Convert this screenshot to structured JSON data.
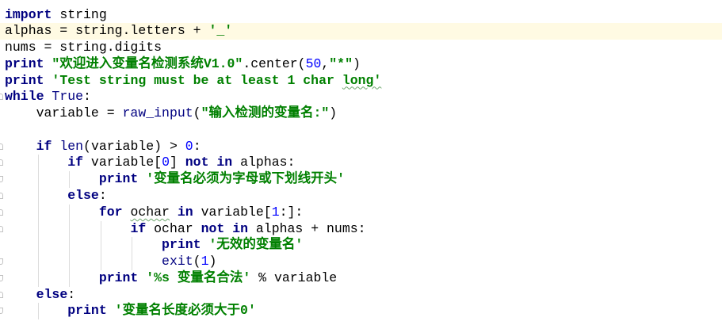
{
  "colors": {
    "background": "#FFFFFF",
    "keyword": "#000080",
    "string": "#008000",
    "number": "#0000FF",
    "builtin": "#000080",
    "text": "#000000",
    "current_line": "#FFFAE3"
  },
  "editor": {
    "lines": [
      {
        "tokens": [
          {
            "type": "keyword",
            "text": "import"
          },
          {
            "type": "plain",
            "text": " string"
          }
        ]
      },
      {
        "current": true,
        "tokens": [
          {
            "type": "plain",
            "text": "alphas = string.letters + "
          },
          {
            "type": "string",
            "text": "'_'"
          }
        ]
      },
      {
        "tokens": [
          {
            "type": "plain",
            "text": "nums = string.digits"
          }
        ]
      },
      {
        "tokens": [
          {
            "type": "keyword",
            "text": "print"
          },
          {
            "type": "plain",
            "text": " "
          },
          {
            "type": "string",
            "text": "\"欢迎进入变量名检测系统V1.0\""
          },
          {
            "type": "plain",
            "text": ".center("
          },
          {
            "type": "number",
            "text": "50"
          },
          {
            "type": "plain",
            "text": ","
          },
          {
            "type": "string",
            "text": "\"*\""
          },
          {
            "type": "plain",
            "text": ")"
          }
        ]
      },
      {
        "tokens": [
          {
            "type": "keyword",
            "text": "print"
          },
          {
            "type": "plain",
            "text": " "
          },
          {
            "type": "string",
            "text": "'Test string must be at least 1 char "
          },
          {
            "type": "string",
            "text": "long'",
            "wavy": true
          }
        ]
      },
      {
        "fold": "start",
        "tokens": [
          {
            "type": "keyword",
            "text": "while"
          },
          {
            "type": "plain",
            "text": " "
          },
          {
            "type": "builtin",
            "text": "True"
          },
          {
            "type": "plain",
            "text": ":"
          }
        ]
      },
      {
        "tokens": [
          {
            "type": "plain",
            "text": "    variable = "
          },
          {
            "type": "builtin",
            "text": "raw_input"
          },
          {
            "type": "plain",
            "text": "("
          },
          {
            "type": "string",
            "text": "\"输入检测的变量名:\""
          },
          {
            "type": "plain",
            "text": ")"
          }
        ]
      },
      {
        "tokens": []
      },
      {
        "fold": "start",
        "tokens": [
          {
            "type": "plain",
            "text": "    "
          },
          {
            "type": "keyword",
            "text": "if"
          },
          {
            "type": "plain",
            "text": " "
          },
          {
            "type": "builtin",
            "text": "len"
          },
          {
            "type": "plain",
            "text": "(variable) > "
          },
          {
            "type": "number",
            "text": "0"
          },
          {
            "type": "plain",
            "text": ":"
          }
        ]
      },
      {
        "fold": "start",
        "tokens": [
          {
            "type": "plain",
            "text": "        "
          },
          {
            "type": "keyword",
            "text": "if"
          },
          {
            "type": "plain",
            "text": " variable["
          },
          {
            "type": "number",
            "text": "0"
          },
          {
            "type": "plain",
            "text": "] "
          },
          {
            "type": "keyword",
            "text": "not"
          },
          {
            "type": "plain",
            "text": " "
          },
          {
            "type": "keyword",
            "text": "in"
          },
          {
            "type": "plain",
            "text": " alphas:"
          }
        ]
      },
      {
        "fold": "end",
        "tokens": [
          {
            "type": "plain",
            "text": "            "
          },
          {
            "type": "keyword",
            "text": "print"
          },
          {
            "type": "plain",
            "text": " "
          },
          {
            "type": "string",
            "text": "'变量名必须为字母或下划线开头'"
          }
        ]
      },
      {
        "fold": "start",
        "tokens": [
          {
            "type": "plain",
            "text": "        "
          },
          {
            "type": "keyword",
            "text": "else"
          },
          {
            "type": "plain",
            "text": ":"
          }
        ]
      },
      {
        "fold": "start",
        "tokens": [
          {
            "type": "plain",
            "text": "            "
          },
          {
            "type": "keyword",
            "text": "for"
          },
          {
            "type": "plain",
            "text": " "
          },
          {
            "type": "plain",
            "text": "ochar",
            "wavy": true
          },
          {
            "type": "plain",
            "text": " "
          },
          {
            "type": "keyword",
            "text": "in"
          },
          {
            "type": "plain",
            "text": " variable["
          },
          {
            "type": "number",
            "text": "1"
          },
          {
            "type": "plain",
            "text": ":]:"
          }
        ]
      },
      {
        "fold": "start",
        "tokens": [
          {
            "type": "plain",
            "text": "                "
          },
          {
            "type": "keyword",
            "text": "if"
          },
          {
            "type": "plain",
            "text": " ochar "
          },
          {
            "type": "keyword",
            "text": "not"
          },
          {
            "type": "plain",
            "text": " "
          },
          {
            "type": "keyword",
            "text": "in"
          },
          {
            "type": "plain",
            "text": " alphas + nums:"
          }
        ]
      },
      {
        "tokens": [
          {
            "type": "plain",
            "text": "                    "
          },
          {
            "type": "keyword",
            "text": "print"
          },
          {
            "type": "plain",
            "text": " "
          },
          {
            "type": "string",
            "text": "'无效的变量名'"
          }
        ]
      },
      {
        "fold": "end",
        "tokens": [
          {
            "type": "plain",
            "text": "                    "
          },
          {
            "type": "builtin",
            "text": "exit"
          },
          {
            "type": "plain",
            "text": "("
          },
          {
            "type": "number",
            "text": "1"
          },
          {
            "type": "plain",
            "text": ")"
          }
        ]
      },
      {
        "fold": "end",
        "tokens": [
          {
            "type": "plain",
            "text": "            "
          },
          {
            "type": "keyword",
            "text": "print"
          },
          {
            "type": "plain",
            "text": " "
          },
          {
            "type": "string",
            "text": "'%s 变量名合法'"
          },
          {
            "type": "plain",
            "text": " % variable"
          }
        ]
      },
      {
        "fold": "start",
        "tokens": [
          {
            "type": "plain",
            "text": "    "
          },
          {
            "type": "keyword",
            "text": "else"
          },
          {
            "type": "plain",
            "text": ":"
          }
        ]
      },
      {
        "fold": "end",
        "tokens": [
          {
            "type": "plain",
            "text": "        "
          },
          {
            "type": "keyword",
            "text": "print"
          },
          {
            "type": "plain",
            "text": " "
          },
          {
            "type": "string",
            "text": "'变量名长度必须大于0'"
          }
        ]
      }
    ]
  }
}
